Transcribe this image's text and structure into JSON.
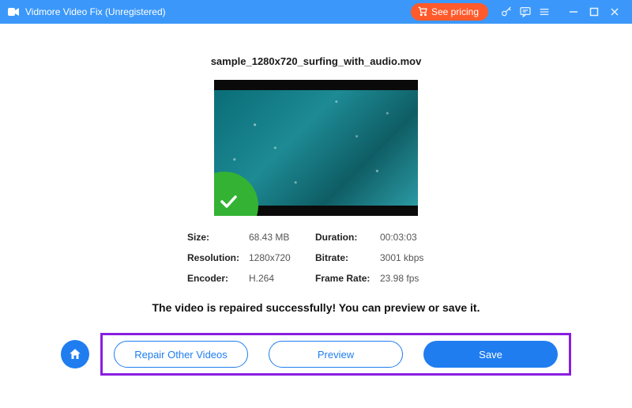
{
  "titlebar": {
    "app_name": "Vidmore Video Fix (Unregistered)",
    "pricing_label": "See pricing"
  },
  "file": {
    "name": "sample_1280x720_surfing_with_audio.mov"
  },
  "meta": {
    "size_label": "Size:",
    "size_value": "68.43 MB",
    "duration_label": "Duration:",
    "duration_value": "00:03:03",
    "resolution_label": "Resolution:",
    "resolution_value": "1280x720",
    "bitrate_label": "Bitrate:",
    "bitrate_value": "3001 kbps",
    "encoder_label": "Encoder:",
    "encoder_value": "H.264",
    "framerate_label": "Frame Rate:",
    "framerate_value": "23.98 fps"
  },
  "success_message": "The video is repaired successfully! You can preview or save it.",
  "buttons": {
    "repair_other": "Repair Other Videos",
    "preview": "Preview",
    "save": "Save"
  }
}
